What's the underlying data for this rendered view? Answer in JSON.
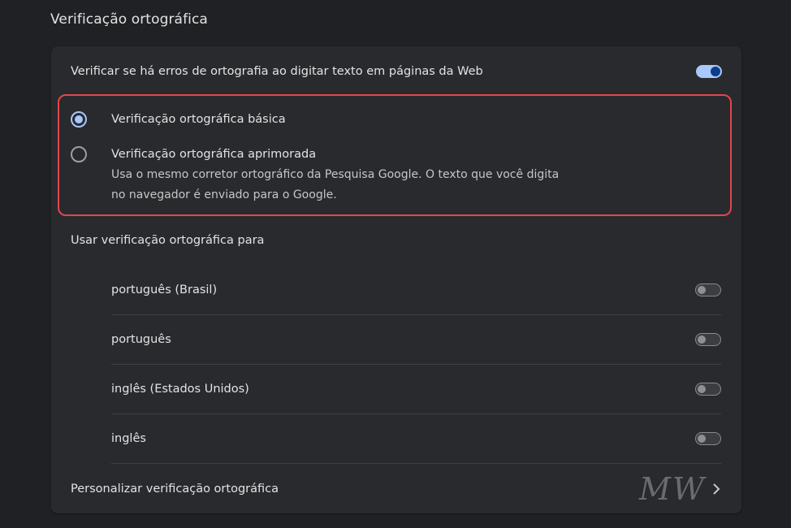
{
  "section_title": "Verificação ortográfica",
  "main_toggle": {
    "label": "Verificar se há erros de ortografia ao digitar texto em páginas da Web",
    "state": "on"
  },
  "radio_options": [
    {
      "label": "Verificação ortográfica básica",
      "checked": true,
      "description": ""
    },
    {
      "label": "Verificação ortográfica aprimorada",
      "checked": false,
      "description": "Usa o mesmo corretor ortográfico da Pesquisa Google. O texto que você digita no navegador é enviado para o Google."
    }
  ],
  "languages_heading": "Usar verificação ortográfica para",
  "languages": [
    {
      "label": "português (Brasil)",
      "state": "off"
    },
    {
      "label": "português",
      "state": "off"
    },
    {
      "label": "inglês (Estados Unidos)",
      "state": "off"
    },
    {
      "label": "inglês",
      "state": "off"
    }
  ],
  "customize_link": {
    "label": "Personalizar verificação ortográfica",
    "icon": "chevron-right-icon"
  },
  "watermark": "MW",
  "colors": {
    "background": "#202124",
    "card": "#292a2d",
    "accent": "#a8c7fa",
    "highlight_border": "#e0474d"
  }
}
